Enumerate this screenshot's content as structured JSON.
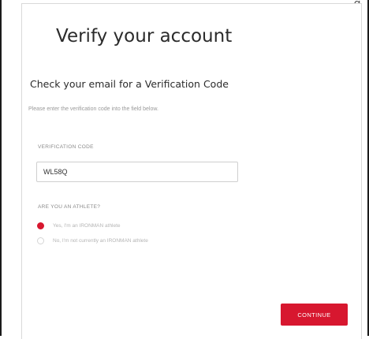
{
  "page": {
    "top_clipped_text": "g"
  },
  "form": {
    "title": "Verify your account",
    "subtitle": "Check your email for a Verification Code",
    "description": "Please enter the verification code into the field below.",
    "code_label": "VERIFICATION CODE",
    "code_value": "WL58Q",
    "athlete_question": "ARE YOU AN ATHLETE?",
    "options": [
      {
        "label": "Yes, I'm an IRONMAN athlete",
        "selected": true
      },
      {
        "label": "No, I'm not currently an IRONMAN athlete",
        "selected": false
      }
    ],
    "continue_label": "CONTINUE"
  },
  "colors": {
    "accent": "#d7172f",
    "text": "#2b2b2b",
    "muted": "#9a9a9a",
    "border": "#cfcfcf"
  }
}
